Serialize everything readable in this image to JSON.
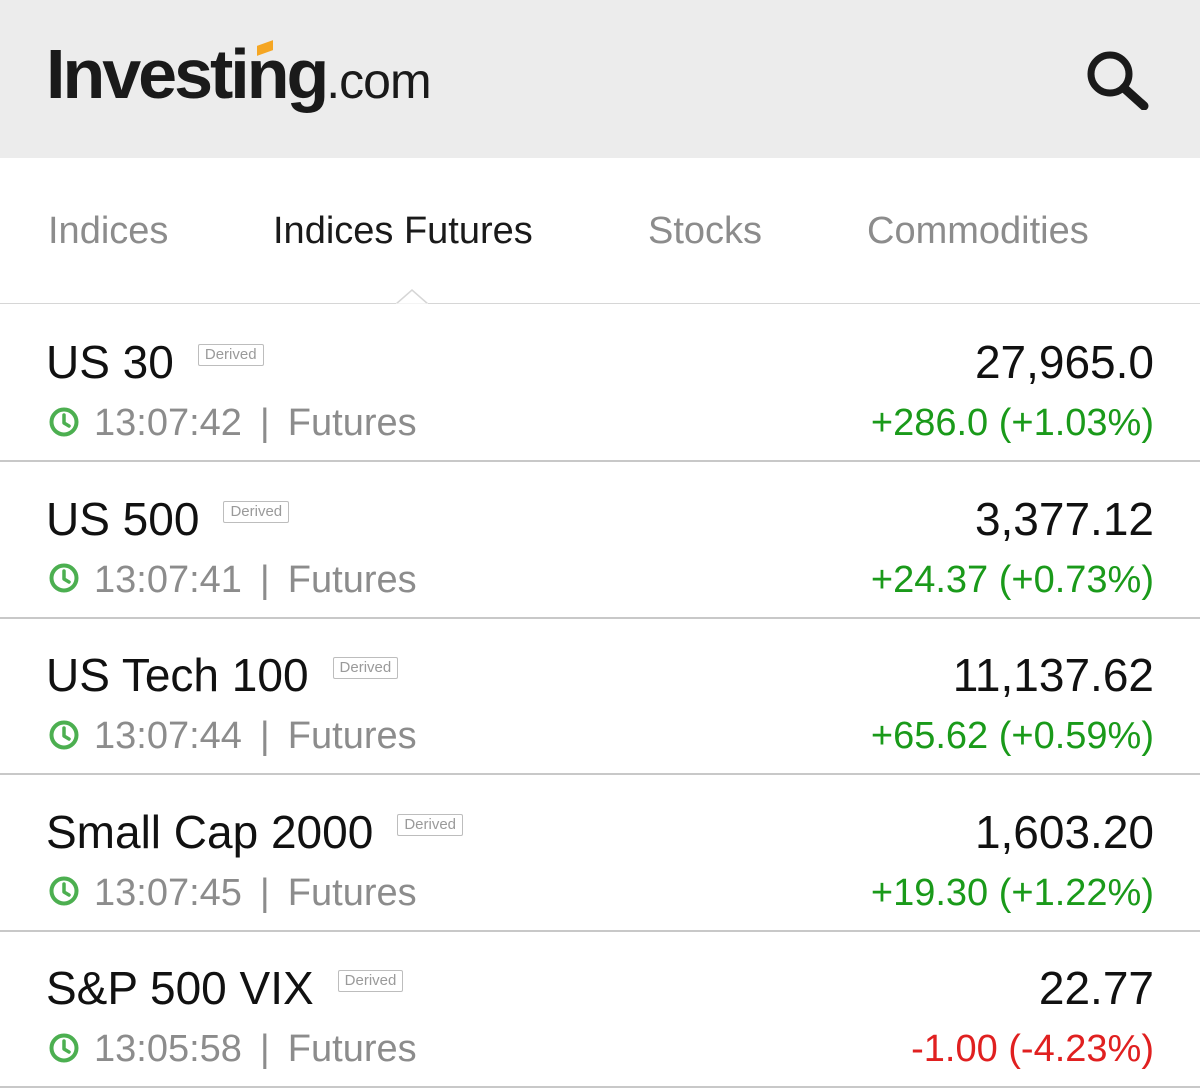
{
  "header": {
    "logo_main": "Investing",
    "logo_suffix": ".com",
    "search_icon": "search-icon",
    "logo_accent_color": "#f5a623"
  },
  "tabs": [
    {
      "label": "Indices",
      "active": false
    },
    {
      "label": "Indices Futures",
      "active": true
    },
    {
      "label": "Stocks",
      "active": false
    },
    {
      "label": "Commodities",
      "active": false
    }
  ],
  "colors": {
    "positive": "#1a9a1a",
    "negative": "#e02020",
    "clock_icon": "#4caf50"
  },
  "rows": [
    {
      "name": "US 30",
      "badge": "Derived",
      "time": "13:07:42",
      "separator": "|",
      "type": "Futures",
      "price": "27,965.0",
      "change": "+286.0 (+1.03%)",
      "direction": "up"
    },
    {
      "name": "US 500",
      "badge": "Derived",
      "time": "13:07:41",
      "separator": "|",
      "type": "Futures",
      "price": "3,377.12",
      "change": "+24.37 (+0.73%)",
      "direction": "up"
    },
    {
      "name": "US Tech 100",
      "badge": "Derived",
      "time": "13:07:44",
      "separator": "|",
      "type": "Futures",
      "price": "11,137.62",
      "change": "+65.62 (+0.59%)",
      "direction": "up"
    },
    {
      "name": "Small Cap 2000",
      "badge": "Derived",
      "time": "13:07:45",
      "separator": "|",
      "type": "Futures",
      "price": "1,603.20",
      "change": "+19.30 (+1.22%)",
      "direction": "up"
    },
    {
      "name": "S&P 500 VIX",
      "badge": "Derived",
      "time": "13:05:58",
      "separator": "|",
      "type": "Futures",
      "price": "22.77",
      "change": "-1.00 (-4.23%)",
      "direction": "down"
    }
  ]
}
